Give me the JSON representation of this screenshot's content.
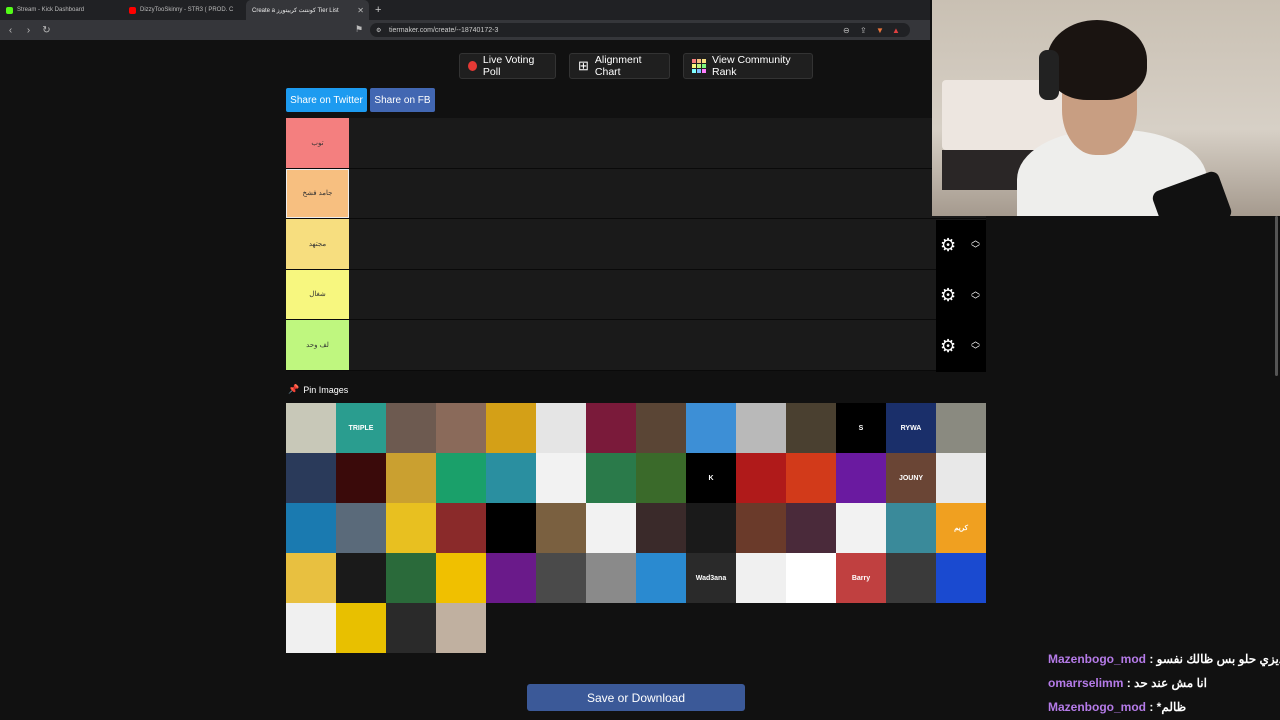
{
  "browser": {
    "tabs": [
      {
        "title": "Stream - Kick Dashboard",
        "favicon_color": "#53fc18",
        "active": false
      },
      {
        "title": "DizzyTooSkinny - STR3 ( PROD. C",
        "favicon_color": "#ff0000",
        "active": false
      },
      {
        "title": "Create a كونتنت كرييتورز Tier List",
        "favicon_color": "#888888",
        "active": true
      }
    ],
    "new_tab_label": "+",
    "url": "tiermaker.com/create/--18740172-3"
  },
  "toolbar": {
    "live_voting_label": "Live Voting Poll",
    "alignment_chart_label": "Alignment Chart",
    "community_rank_label": "View Community Rank"
  },
  "share": {
    "twitter_label": "Share on Twitter",
    "fb_label": "Share on FB"
  },
  "tiers": [
    {
      "label": "توب",
      "color": "#f47f7f"
    },
    {
      "label": "جامد فشخ",
      "color": "#f7bf80"
    },
    {
      "label": "مجتهد",
      "color": "#f7de7f"
    },
    {
      "label": "شغال",
      "color": "#f7f77f"
    },
    {
      "label": "لف وحد",
      "color": "#bff77f"
    }
  ],
  "pin_images_label": "Pin Images",
  "image_tiles": [
    {
      "color": "#c8c8b8",
      "text": ""
    },
    {
      "color": "#2a9d8f",
      "text": "TRIPLE"
    },
    {
      "color": "#6d5a50",
      "text": ""
    },
    {
      "color": "#8a6a5a",
      "text": ""
    },
    {
      "color": "#d4a017",
      "text": ""
    },
    {
      "color": "#e5e5e5",
      "text": ""
    },
    {
      "color": "#7a1a3a",
      "text": ""
    },
    {
      "color": "#5a4535",
      "text": ""
    },
    {
      "color": "#3d8fd6",
      "text": ""
    },
    {
      "color": "#b9b9b9",
      "text": ""
    },
    {
      "color": "#4a4030",
      "text": ""
    },
    {
      "color": "#000000",
      "text": "S"
    },
    {
      "color": "#1a2f6a",
      "text": "RYWA"
    },
    {
      "color": "#8a8a80",
      "text": ""
    },
    {
      "color": "#2a3a5a",
      "text": ""
    },
    {
      "color": "#3a0a0a",
      "text": ""
    },
    {
      "color": "#caa030",
      "text": ""
    },
    {
      "color": "#1aa06a",
      "text": ""
    },
    {
      "color": "#2a8fa0",
      "text": ""
    },
    {
      "color": "#f2f2f2",
      "text": ""
    },
    {
      "color": "#2a7a4a",
      "text": ""
    },
    {
      "color": "#3a6a2a",
      "text": ""
    },
    {
      "color": "#000000",
      "text": "K"
    },
    {
      "color": "#b01a1a",
      "text": ""
    },
    {
      "color": "#d23a1a",
      "text": ""
    },
    {
      "color": "#6a1aa0",
      "text": ""
    },
    {
      "color": "#6a4535",
      "text": "JOUNY"
    },
    {
      "color": "#e8e8e8",
      "text": ""
    },
    {
      "color": "#1a7ab0",
      "text": ""
    },
    {
      "color": "#5a6a7a",
      "text": ""
    },
    {
      "color": "#e8c020",
      "text": ""
    },
    {
      "color": "#8a2a2a",
      "text": ""
    },
    {
      "color": "#000000",
      "text": ""
    },
    {
      "color": "#7a6040",
      "text": ""
    },
    {
      "color": "#f2f2f2",
      "text": ""
    },
    {
      "color": "#3a2a2a",
      "text": ""
    },
    {
      "color": "#1a1a1a",
      "text": ""
    },
    {
      "color": "#6a3a2a",
      "text": ""
    },
    {
      "color": "#4a2a3a",
      "text": ""
    },
    {
      "color": "#f2f2f2",
      "text": ""
    },
    {
      "color": "#3a8a9a",
      "text": ""
    },
    {
      "color": "#f0a020",
      "text": "كريم"
    },
    {
      "color": "#e8c040",
      "text": ""
    },
    {
      "color": "#1a1a1a",
      "text": ""
    },
    {
      "color": "#2a6a3a",
      "text": ""
    },
    {
      "color": "#f0c000",
      "text": ""
    },
    {
      "color": "#6a1a8a",
      "text": ""
    },
    {
      "color": "#4a4a4a",
      "text": ""
    },
    {
      "color": "#8a8a8a",
      "text": ""
    },
    {
      "color": "#2a8ad0",
      "text": ""
    },
    {
      "color": "#2a2a2a",
      "text": "Wad3ana"
    },
    {
      "color": "#f0f0f0",
      "text": ""
    },
    {
      "color": "#ffffff",
      "text": ""
    },
    {
      "color": "#c04040",
      "text": "Barry"
    },
    {
      "color": "#3a3a3a",
      "text": ""
    },
    {
      "color": "#1a4ad0",
      "text": ""
    },
    {
      "color": "#f0f0f0",
      "text": ""
    },
    {
      "color": "#e8c000",
      "text": ""
    },
    {
      "color": "#2a2a2a",
      "text": ""
    },
    {
      "color": "#c0b0a0",
      "text": ""
    }
  ],
  "save_label": "Save or Download",
  "chat": [
    {
      "user": "Mazenbogo_mod",
      "sep": " : ",
      "message": "ديزي حلو بس ظالك نفسو"
    },
    {
      "user": "omarrselimm",
      "sep": " : ",
      "message": "انا مش عند حد"
    },
    {
      "user": "Mazenbogo_mod",
      "sep": " : ",
      "message": "*ظالم"
    }
  ]
}
